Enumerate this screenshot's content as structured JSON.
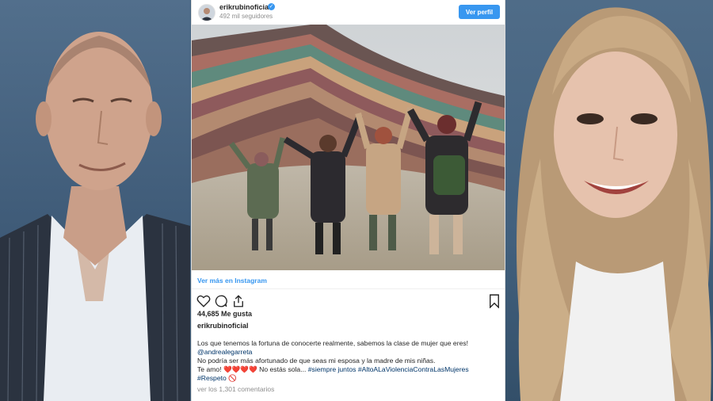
{
  "post": {
    "username": "erikrubinoficial",
    "followers": "492 mil seguidores",
    "view_profile": "Ver perfil",
    "view_more": "Ver más en Instagram",
    "likes": "44,685 Me gusta",
    "author": "erikrubinoficial",
    "caption": {
      "line1": "Los que tenemos la fortuna de conocerte realmente, sabemos la clase de mujer que eres!",
      "mention": "@andrealegarreta",
      "line3": "No podría ser más afortunado de que seas mi esposa y la madre de mis niñas.",
      "line4_start": "Te amo! ❤️❤️❤️❤️ No estás sola... ",
      "hashtags_1": "#siempre juntos #AltoALaViolenciaContraLasMujeres",
      "hashtag_2": "#Respeto",
      "emoji_end": "🚫"
    },
    "comments": "ver los 1,301 comentarios"
  },
  "colors": {
    "accent": "#3897f0",
    "link": "#003569",
    "text": "#262626",
    "muted": "#8e8e8e",
    "background": "#3f5f7c"
  },
  "icons": [
    "verified-badge-icon",
    "heart-icon",
    "comment-icon",
    "share-icon",
    "bookmark-icon"
  ]
}
